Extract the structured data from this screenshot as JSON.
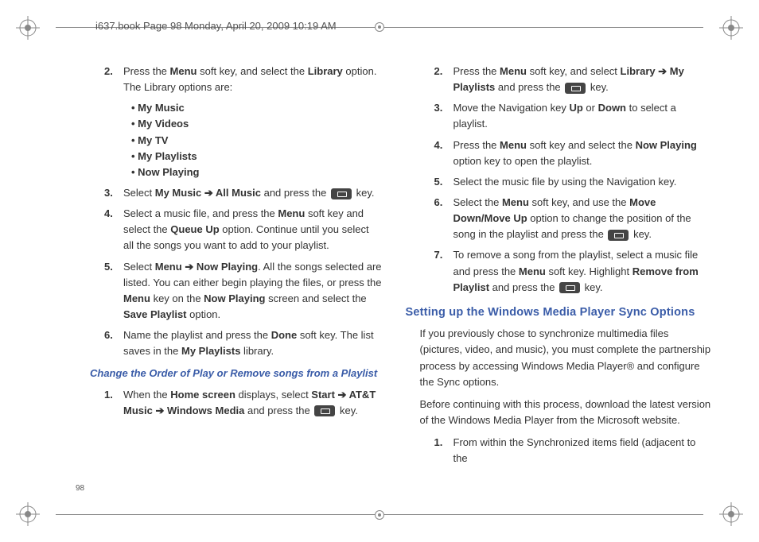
{
  "header": "i637.book  Page 98  Monday, April 20, 2009  10:19 AM",
  "pageNumber": "98",
  "left": {
    "step2": {
      "num": "2.",
      "pre": "Press the ",
      "b1": "Menu",
      "mid": " soft key, and select the ",
      "b2": "Library",
      "post": " option. The Library options are:"
    },
    "bullets": {
      "i1": "My Music",
      "i2": "My Videos",
      "i3": "My TV",
      "i4": "My Playlists",
      "i5": "Now Playing"
    },
    "step3": {
      "num": "3.",
      "pre": "Select ",
      "b1": "My Music",
      "arrow": " ➔ ",
      "b2": "All Music",
      "mid": " and press the ",
      "post": " key."
    },
    "step4": {
      "num": "4.",
      "pre": "Select a music file, and press the ",
      "b1": "Menu",
      "mid": " soft key and select the ",
      "b2": "Queue Up",
      "post": " option. Continue until you select all the songs you want to add to your playlist."
    },
    "step5": {
      "num": "5.",
      "pre": "Select ",
      "b1": "Menu",
      "arrow": " ➔ ",
      "b2": "Now Playing",
      "mid1": ". All the songs selected are listed. You can either begin playing the files, or press the ",
      "b3": "Menu",
      "mid2": " key on the ",
      "b4": "Now Playing",
      "mid3": " screen and select the ",
      "b5": "Save Playlist",
      "post": " option."
    },
    "step6": {
      "num": "6.",
      "pre": "Name the playlist and press the ",
      "b1": "Done",
      "mid": " soft key. The list saves in the ",
      "b2": "My Playlists",
      "post": " library."
    },
    "subheading": "Change the Order of Play or Remove songs from a Playlist",
    "cstep1": {
      "num": "1.",
      "pre": "When the ",
      "b1": "Home screen",
      "mid1": " displays, select ",
      "b2": "Start",
      "arrow1": " ➔ ",
      "b3": "AT&T Music",
      "arrow2": " ➔ ",
      "b4": "Windows Media",
      "mid2": " and press the ",
      "post": " key."
    }
  },
  "right": {
    "step2": {
      "num": "2.",
      "pre": "Press the ",
      "b1": "Menu",
      "mid1": " soft key, and select ",
      "b2": "Library",
      "arrow": " ➔ ",
      "b3": "My Playlists",
      "mid2": " and press the ",
      "post": " key."
    },
    "step3": {
      "num": "3.",
      "pre": "Move the Navigation key ",
      "b1": "Up",
      "mid": " or ",
      "b2": "Down",
      "post": " to select a playlist."
    },
    "step4": {
      "num": "4.",
      "pre": "Press the ",
      "b1": "Menu",
      "mid": " soft key and select the ",
      "b2": "Now Playing",
      "post": " option key to open the playlist."
    },
    "step5": {
      "num": "5.",
      "text": "Select the music file by using the Navigation key."
    },
    "step6": {
      "num": "6.",
      "pre": "Select the ",
      "b1": "Menu",
      "mid1": " soft key, and use the ",
      "b2": "Move Down/Move Up",
      "mid2": " option to change the position of the song in the playlist and press the ",
      "post": " key."
    },
    "step7": {
      "num": "7.",
      "pre": "To remove a song from the playlist, select a music file and press the ",
      "b1": "Menu",
      "mid1": " soft key. Highlight ",
      "b2": "Remove from Playlist",
      "mid2": " and press the ",
      "post": " key."
    },
    "heading": "Setting up the Windows Media Player Sync Options",
    "para1": "If you previously chose to synchronize multimedia files (pictures, video, and music), you must complete the partnership process by accessing Windows Media Player® and configure the Sync options.",
    "para2": "Before continuing with this process, download the latest version of the Windows Media Player from the Microsoft website.",
    "sstep1": {
      "num": "1.",
      "text": "From within the Synchronized items field (adjacent to the"
    }
  }
}
